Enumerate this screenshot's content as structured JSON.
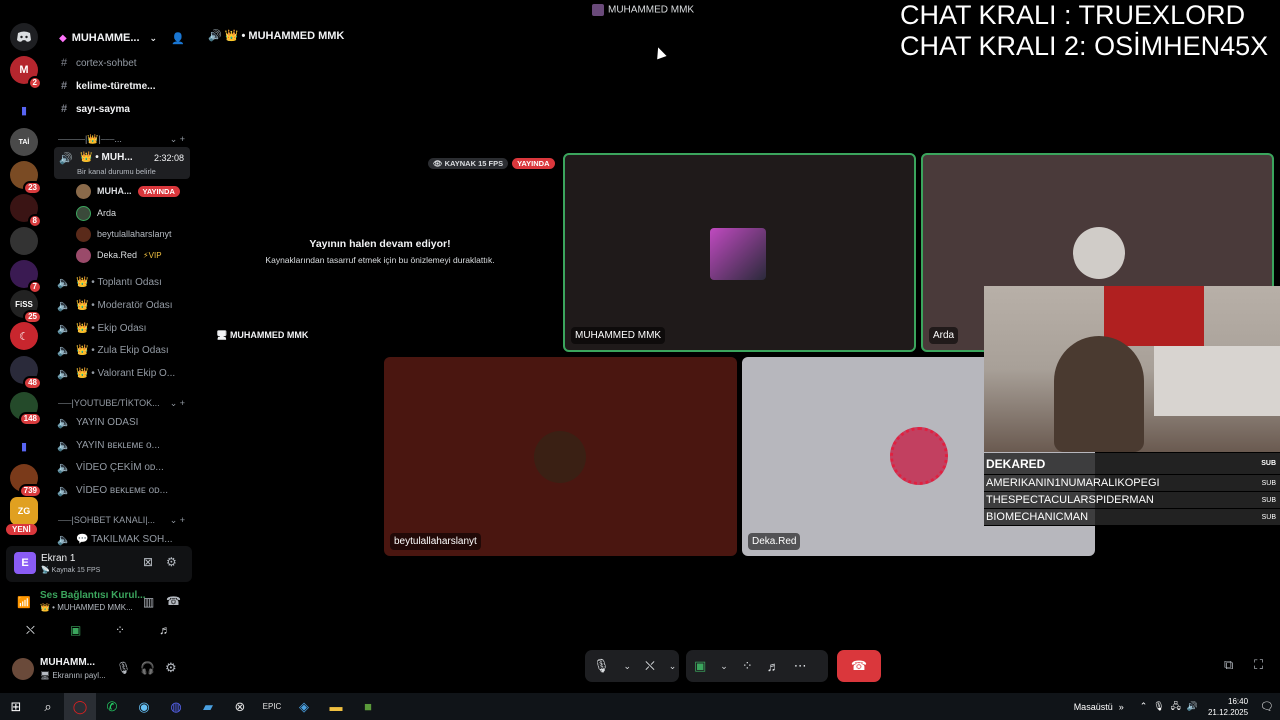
{
  "window": {
    "title": "MUHAMMED MMK",
    "stream_credit_1": "CHAT KRALI : TRUEXLORD",
    "stream_credit_2": "CHAT KRALI 2: OSİMHEN45X"
  },
  "rail": {
    "servers": [
      {
        "name": "discord-home-icon",
        "color": "#1e1f22",
        "badge": ""
      },
      {
        "name": "server-m",
        "color": "#b5262e",
        "badge": "2"
      },
      {
        "name": "folder",
        "color": "#1e1f22",
        "badge": ""
      },
      {
        "name": "server-tai",
        "color": "#4a4a4a",
        "badge": ""
      },
      {
        "name": "server-2",
        "color": "#7a4b24",
        "badge": "23"
      },
      {
        "name": "server-3",
        "color": "#3a1414",
        "badge": "8"
      },
      {
        "name": "server-4",
        "color": "#333",
        "badge": ""
      },
      {
        "name": "server-5",
        "color": "#3a1a52",
        "badge": "7"
      },
      {
        "name": "server-fiss",
        "color": "#222",
        "badge": "25"
      },
      {
        "name": "server-crescent",
        "color": "#c8262e",
        "badge": ""
      },
      {
        "name": "server-6",
        "color": "#2a2a3a",
        "badge": "48"
      },
      {
        "name": "server-7",
        "color": "#244a2a",
        "badge": "148"
      },
      {
        "name": "folder-2",
        "color": "#1e1f22",
        "badge": ""
      },
      {
        "name": "server-8",
        "color": "#7a3a1a",
        "badge": "739"
      },
      {
        "name": "server-zg",
        "color": "#e0a020",
        "badge": ""
      }
    ],
    "new_label": "YENİ"
  },
  "sidebar": {
    "server_name": "MUHAMME...",
    "channels_top": [
      {
        "icon": "#",
        "label": "cortex-sohbet",
        "bright": false
      },
      {
        "icon": "#",
        "label": "kelime-türetme...",
        "bright": true
      },
      {
        "icon": "#",
        "label": "sayı-sayma",
        "bright": true
      }
    ],
    "category_1": "⎯⎯⎯⎯⎯⎯|👑|⎯⎯⎯...",
    "active_voice": {
      "label": "MUH...",
      "timer": "2:32:08",
      "status": "Bir kanal durumu belirle"
    },
    "voice_users": [
      {
        "name": "MUHA...",
        "live": "YAYINDA",
        "color": "#8a6a4a"
      },
      {
        "name": "Arda",
        "live": "",
        "color": "#3a4a3a"
      },
      {
        "name": "beytulallaharslanyt",
        "live": "",
        "color": "#5a2a1a"
      },
      {
        "name": "Deka.Red",
        "live": "",
        "extra": "⚡VIP",
        "color": "#9a4a6a"
      }
    ],
    "voice_channels": [
      "Toplantı Odası",
      "Moderatör Odası",
      "Ekip Odası",
      "Zula Ekip Odası",
      "Valorant Ekip O..."
    ],
    "category_2": "⎯⎯⎯|YOUTUBE/TİKTOK...",
    "media_channels": [
      "YAYIN ODASI",
      "YAYIN ʙᴇᴋʟᴇᴍᴇ ᴏ...",
      "VİDEO ÇEKİM ᴏᴅ...",
      "VİDEO ʙᴇᴋʟᴇᴍᴇ ᴏᴅ..."
    ],
    "category_3": "⎯⎯⎯|SOHBET KANALI|...",
    "text_channel_last": "TAKILMAK SOH..."
  },
  "stream_panel": {
    "title": "Ekran 1",
    "subtitle": "Kaynak 15 FPS"
  },
  "voice_panel": {
    "status": "Ses Bağlantısı Kurul...",
    "channel": "👑 • MUHAMMED MMK..."
  },
  "user_panel": {
    "name": "MUHAMM...",
    "status": "Ekranını payl..."
  },
  "main": {
    "channel_header": "MUHAMMED MMK",
    "stream_badge_fps": "KAYNAK 15 FPS",
    "stream_badge_live": "YAYINDA",
    "paused_title": "Yayının halen devam ediyor!",
    "paused_desc": "Kaynaklarından tasarruf etmek için bu önizlemeyi duraklattık.",
    "own_stream_label": "MUHAMMED MMK",
    "tiles": [
      {
        "name": "MUHAMMED MMK"
      },
      {
        "name": "Arda"
      },
      {
        "name": "beytulallaharslanyt"
      },
      {
        "name": "Deka.Red"
      }
    ]
  },
  "overlay": {
    "top_name": "DEKARED",
    "subs": [
      "AMERIKANIN1NUMARALIKOPEGI",
      "THESPECTACULARSPIDERMAN",
      "BIOMECHANICMAN"
    ],
    "sub_label": "SUB"
  },
  "taskbar": {
    "location": "Masaüstü",
    "time": "16:40",
    "date": "21.12.2025"
  },
  "colors": {
    "live_red": "#da373c",
    "speaking_green": "#3ba55d",
    "hangup_red": "#da373c"
  }
}
